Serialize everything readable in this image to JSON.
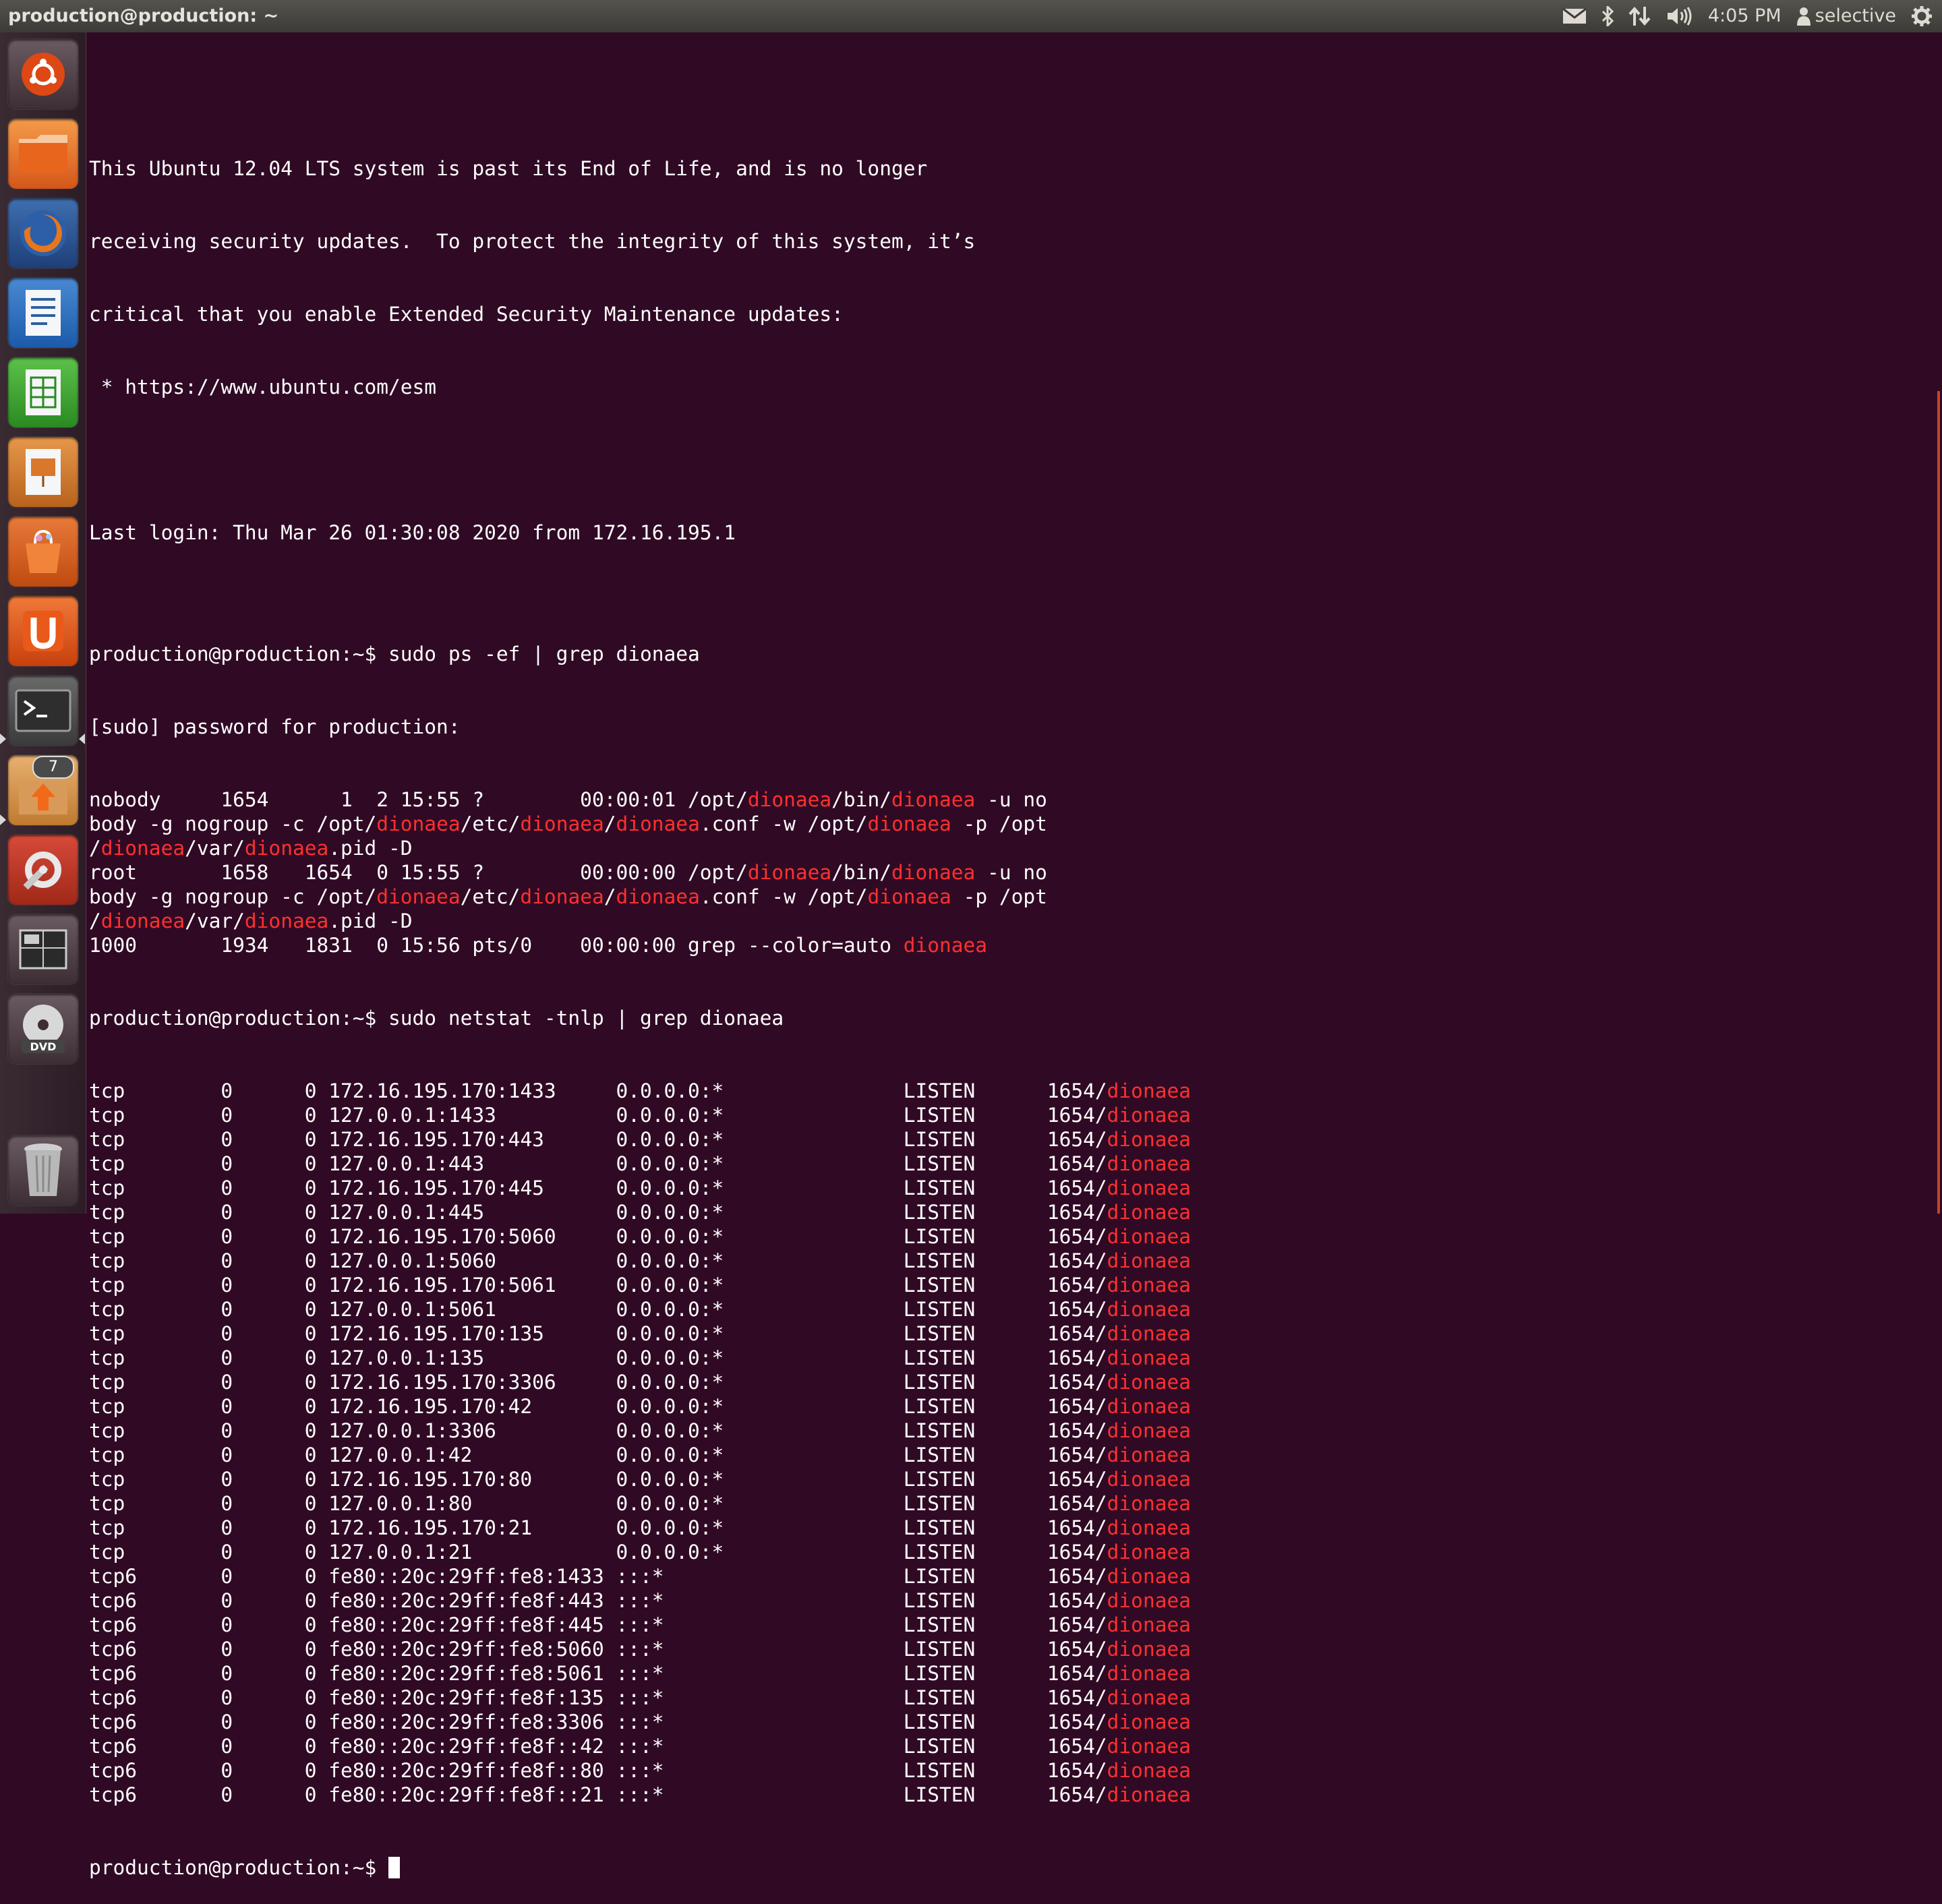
{
  "topbar": {
    "title": "production@production: ~",
    "time": "4:05 PM",
    "user": "selective",
    "icons": [
      "mail-icon",
      "bluetooth-icon",
      "network-icon",
      "volume-icon",
      "user-icon",
      "gear-icon"
    ]
  },
  "launcher": {
    "items": [
      "dash-home-icon",
      "files-icon",
      "firefox-icon",
      "writer-icon",
      "calc-icon",
      "impress-icon",
      "software-center-icon",
      "ubuntu-one-icon",
      "terminal-icon",
      "updater-icon",
      "system-settings-icon",
      "workspace-switcher-icon",
      "dvd-icon",
      "trash-icon"
    ],
    "updater_badge": "7"
  },
  "colors": {
    "background": "#300a24",
    "highlight": "#ff3030",
    "text": "#ffffff"
  },
  "terminal": {
    "prompt": "production@production:~$ ",
    "motd": [
      "This Ubuntu 12.04 LTS system is past its End of Life, and is no longer",
      "receiving security updates.  To protect the integrity of this system, it’s",
      "critical that you enable Extended Security Maintenance updates:",
      " * https://www.ubuntu.com/esm",
      "",
      "Last login: Thu Mar 26 01:30:08 2020 from 172.16.195.1"
    ],
    "cmd1": "sudo ps -ef | grep dionaea",
    "sudo_prompt": "[sudo] password for production:",
    "ps_rows": [
      [
        "nobody     1654      1  2 15:55 ?        00:00:01 /opt/[dionaea]/bin/[dionaea] -u no",
        "body -g nogroup -c /opt/[dionaea]/etc/[dionaea]/[dionaea].conf -w /opt/[dionaea] -p /opt",
        "/[dionaea]/var/[dionaea].pid -D"
      ],
      [
        "root       1658   1654  0 15:55 ?        00:00:00 /opt/[dionaea]/bin/[dionaea] -u no",
        "body -g nogroup -c /opt/[dionaea]/etc/[dionaea]/[dionaea].conf -w /opt/[dionaea] -p /opt",
        "/[dionaea]/var/[dionaea].pid -D"
      ],
      [
        "1000       1934   1831  0 15:56 pts/0    00:00:00 grep --color=auto [dionaea]"
      ]
    ],
    "cmd2": "sudo netstat -tnlp | grep dionaea",
    "netstat_rows": [
      [
        "tcp",
        "0",
        "0",
        "172.16.195.170:1433",
        "0.0.0.0:*",
        "LISTEN",
        "1654/",
        "dionaea"
      ],
      [
        "tcp",
        "0",
        "0",
        "127.0.0.1:1433",
        "0.0.0.0:*",
        "LISTEN",
        "1654/",
        "dionaea"
      ],
      [
        "tcp",
        "0",
        "0",
        "172.16.195.170:443",
        "0.0.0.0:*",
        "LISTEN",
        "1654/",
        "dionaea"
      ],
      [
        "tcp",
        "0",
        "0",
        "127.0.0.1:443",
        "0.0.0.0:*",
        "LISTEN",
        "1654/",
        "dionaea"
      ],
      [
        "tcp",
        "0",
        "0",
        "172.16.195.170:445",
        "0.0.0.0:*",
        "LISTEN",
        "1654/",
        "dionaea"
      ],
      [
        "tcp",
        "0",
        "0",
        "127.0.0.1:445",
        "0.0.0.0:*",
        "LISTEN",
        "1654/",
        "dionaea"
      ],
      [
        "tcp",
        "0",
        "0",
        "172.16.195.170:5060",
        "0.0.0.0:*",
        "LISTEN",
        "1654/",
        "dionaea"
      ],
      [
        "tcp",
        "0",
        "0",
        "127.0.0.1:5060",
        "0.0.0.0:*",
        "LISTEN",
        "1654/",
        "dionaea"
      ],
      [
        "tcp",
        "0",
        "0",
        "172.16.195.170:5061",
        "0.0.0.0:*",
        "LISTEN",
        "1654/",
        "dionaea"
      ],
      [
        "tcp",
        "0",
        "0",
        "127.0.0.1:5061",
        "0.0.0.0:*",
        "LISTEN",
        "1654/",
        "dionaea"
      ],
      [
        "tcp",
        "0",
        "0",
        "172.16.195.170:135",
        "0.0.0.0:*",
        "LISTEN",
        "1654/",
        "dionaea"
      ],
      [
        "tcp",
        "0",
        "0",
        "127.0.0.1:135",
        "0.0.0.0:*",
        "LISTEN",
        "1654/",
        "dionaea"
      ],
      [
        "tcp",
        "0",
        "0",
        "172.16.195.170:3306",
        "0.0.0.0:*",
        "LISTEN",
        "1654/",
        "dionaea"
      ],
      [
        "tcp",
        "0",
        "0",
        "172.16.195.170:42",
        "0.0.0.0:*",
        "LISTEN",
        "1654/",
        "dionaea"
      ],
      [
        "tcp",
        "0",
        "0",
        "127.0.0.1:3306",
        "0.0.0.0:*",
        "LISTEN",
        "1654/",
        "dionaea"
      ],
      [
        "tcp",
        "0",
        "0",
        "127.0.0.1:42",
        "0.0.0.0:*",
        "LISTEN",
        "1654/",
        "dionaea"
      ],
      [
        "tcp",
        "0",
        "0",
        "172.16.195.170:80",
        "0.0.0.0:*",
        "LISTEN",
        "1654/",
        "dionaea"
      ],
      [
        "tcp",
        "0",
        "0",
        "127.0.0.1:80",
        "0.0.0.0:*",
        "LISTEN",
        "1654/",
        "dionaea"
      ],
      [
        "tcp",
        "0",
        "0",
        "172.16.195.170:21",
        "0.0.0.0:*",
        "LISTEN",
        "1654/",
        "dionaea"
      ],
      [
        "tcp",
        "0",
        "0",
        "127.0.0.1:21",
        "0.0.0.0:*",
        "LISTEN",
        "1654/",
        "dionaea"
      ],
      [
        "tcp6",
        "0",
        "0",
        "fe80::20c:29ff:fe8:1433",
        ":::*",
        "LISTEN",
        "1654/",
        "dionaea"
      ],
      [
        "tcp6",
        "0",
        "0",
        "fe80::20c:29ff:fe8f:443",
        ":::*",
        "LISTEN",
        "1654/",
        "dionaea"
      ],
      [
        "tcp6",
        "0",
        "0",
        "fe80::20c:29ff:fe8f:445",
        ":::*",
        "LISTEN",
        "1654/",
        "dionaea"
      ],
      [
        "tcp6",
        "0",
        "0",
        "fe80::20c:29ff:fe8:5060",
        ":::*",
        "LISTEN",
        "1654/",
        "dionaea"
      ],
      [
        "tcp6",
        "0",
        "0",
        "fe80::20c:29ff:fe8:5061",
        ":::*",
        "LISTEN",
        "1654/",
        "dionaea"
      ],
      [
        "tcp6",
        "0",
        "0",
        "fe80::20c:29ff:fe8f:135",
        ":::*",
        "LISTEN",
        "1654/",
        "dionaea"
      ],
      [
        "tcp6",
        "0",
        "0",
        "fe80::20c:29ff:fe8:3306",
        ":::*",
        "LISTEN",
        "1654/",
        "dionaea"
      ],
      [
        "tcp6",
        "0",
        "0",
        "fe80::20c:29ff:fe8f::42",
        ":::*",
        "LISTEN",
        "1654/",
        "dionaea"
      ],
      [
        "tcp6",
        "0",
        "0",
        "fe80::20c:29ff:fe8f::80",
        ":::*",
        "LISTEN",
        "1654/",
        "dionaea"
      ],
      [
        "tcp6",
        "0",
        "0",
        "fe80::20c:29ff:fe8f::21",
        ":::*",
        "LISTEN",
        "1654/",
        "dionaea"
      ]
    ]
  }
}
